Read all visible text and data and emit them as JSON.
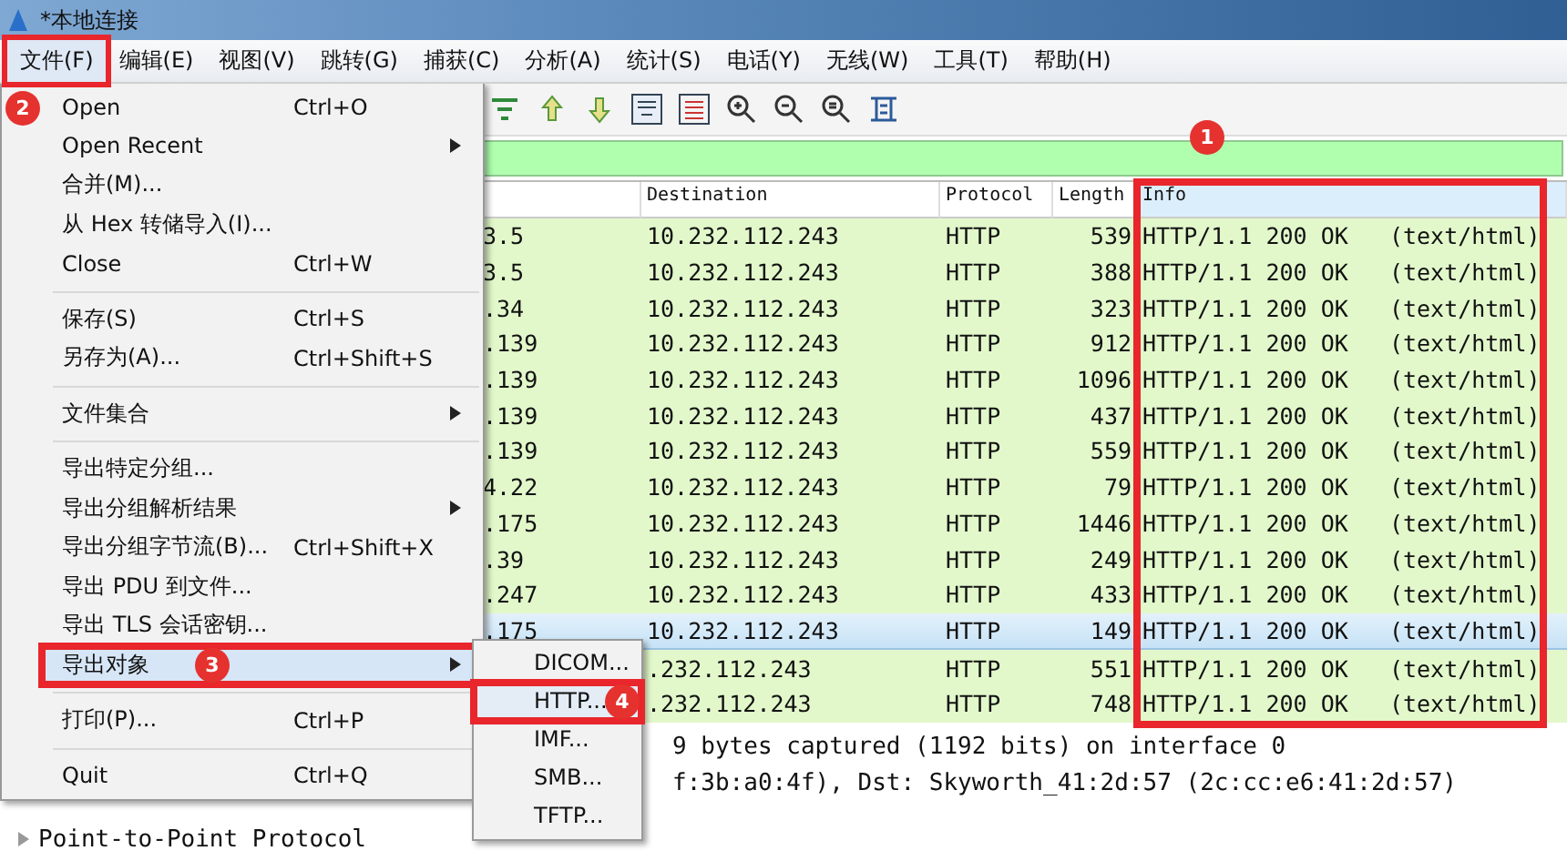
{
  "window": {
    "title": "*本地连接"
  },
  "menu_bar": [
    {
      "label": "文件(F)",
      "selected": true,
      "annotation": "2"
    },
    {
      "label": "编辑(E)",
      "selected": false
    },
    {
      "label": "视图(V)",
      "selected": false
    },
    {
      "label": "跳转(G)",
      "selected": false
    },
    {
      "label": "捕获(C)",
      "selected": false
    },
    {
      "label": "分析(A)",
      "selected": false
    },
    {
      "label": "统计(S)",
      "selected": false
    },
    {
      "label": "电话(Y)",
      "selected": false
    },
    {
      "label": "无线(W)",
      "selected": false
    },
    {
      "label": "工具(T)",
      "selected": false
    },
    {
      "label": "帮助(H)",
      "selected": false
    }
  ],
  "file_menu": {
    "groups": [
      [
        {
          "label": "Open",
          "shortcut": "Ctrl+O"
        },
        {
          "label": "Open Recent",
          "submenu": true
        },
        {
          "label": "合并(M)..."
        },
        {
          "label": "从 Hex 转储导入(I)..."
        },
        {
          "label": "Close",
          "shortcut": "Ctrl+W"
        }
      ],
      [
        {
          "label": "保存(S)",
          "shortcut": "Ctrl+S"
        },
        {
          "label": "另存为(A)...",
          "shortcut": "Ctrl+Shift+S"
        }
      ],
      [
        {
          "label": "文件集合",
          "submenu": true
        }
      ],
      [
        {
          "label": "导出特定分组..."
        },
        {
          "label": "导出分组解析结果",
          "submenu": true
        },
        {
          "label": "导出分组字节流(B)...",
          "shortcut": "Ctrl+Shift+X"
        },
        {
          "label": "导出 PDU 到文件..."
        },
        {
          "label": "导出 TLS 会话密钥..."
        },
        {
          "label": "导出对象",
          "submenu": true,
          "selected": true,
          "annotation": "3"
        }
      ],
      [
        {
          "label": "打印(P)...",
          "shortcut": "Ctrl+P"
        }
      ],
      [
        {
          "label": "Quit",
          "shortcut": "Ctrl+Q"
        }
      ]
    ]
  },
  "export_objects_menu": [
    {
      "label": "DICOM...",
      "selected": false
    },
    {
      "label": "HTTP...",
      "selected": true,
      "annotation": "4"
    },
    {
      "label": "IMF...",
      "selected": false
    },
    {
      "label": "SMB...",
      "selected": false
    },
    {
      "label": "TFTP...",
      "selected": false
    }
  ],
  "packet_list": {
    "columns": [
      "Destination",
      "Protocol",
      "Length",
      "Info"
    ],
    "info_annotation": "1",
    "rows": [
      {
        "source": "3.5",
        "destination": "10.232.112.243",
        "protocol": "HTTP",
        "length": "539",
        "info": "HTTP/1.1 200 OK   (text/html)",
        "selected": false
      },
      {
        "source": "3.5",
        "destination": "10.232.112.243",
        "protocol": "HTTP",
        "length": "388",
        "info": "HTTP/1.1 200 OK   (text/html)",
        "selected": false
      },
      {
        "source": ".34",
        "destination": "10.232.112.243",
        "protocol": "HTTP",
        "length": "323",
        "info": "HTTP/1.1 200 OK   (text/html)",
        "selected": false
      },
      {
        "source": ".139",
        "destination": "10.232.112.243",
        "protocol": "HTTP",
        "length": "912",
        "info": "HTTP/1.1 200 OK   (text/html)",
        "selected": false
      },
      {
        "source": ".139",
        "destination": "10.232.112.243",
        "protocol": "HTTP",
        "length": "1096",
        "info": "HTTP/1.1 200 OK   (text/html)",
        "selected": false
      },
      {
        "source": ".139",
        "destination": "10.232.112.243",
        "protocol": "HTTP",
        "length": "437",
        "info": "HTTP/1.1 200 OK   (text/html)",
        "selected": false
      },
      {
        "source": ".139",
        "destination": "10.232.112.243",
        "protocol": "HTTP",
        "length": "559",
        "info": "HTTP/1.1 200 OK   (text/html)",
        "selected": false
      },
      {
        "source": "4.22",
        "destination": "10.232.112.243",
        "protocol": "HTTP",
        "length": "79",
        "info": "HTTP/1.1 200 OK   (text/html)",
        "selected": false
      },
      {
        "source": ".175",
        "destination": "10.232.112.243",
        "protocol": "HTTP",
        "length": "1446",
        "info": "HTTP/1.1 200 OK   (text/html)",
        "selected": false
      },
      {
        "source": ".39",
        "destination": "10.232.112.243",
        "protocol": "HTTP",
        "length": "249",
        "info": "HTTP/1.1 200 OK   (text/html)",
        "selected": false
      },
      {
        "source": ".247",
        "destination": "10.232.112.243",
        "protocol": "HTTP",
        "length": "433",
        "info": "HTTP/1.1 200 OK   (text/html)",
        "selected": false
      },
      {
        "source": ".175",
        "destination": "10.232.112.243",
        "protocol": "HTTP",
        "length": "149",
        "info": "HTTP/1.1 200 OK   (text/html)",
        "selected": true
      },
      {
        "destination": ".232.112.243",
        "protocol": "HTTP",
        "length": "551",
        "info": "HTTP/1.1 200 OK   (text/html)",
        "selected": false
      },
      {
        "destination": ".232.112.243",
        "protocol": "HTTP",
        "length": "748",
        "info": "HTTP/1.1 200 OK   (text/html)",
        "selected": false
      }
    ]
  },
  "packet_details": [
    {
      "kind": "partial",
      "text": "9 bytes captured (1192 bits) on interface 0"
    },
    {
      "kind": "partial",
      "text": "f:3b:a0:4f), Dst: Skyworth_41:2d:57 (2c:cc:e6:41:2d:57)"
    },
    {
      "kind": "node",
      "text": "Point-to-Point Protocol"
    }
  ]
}
